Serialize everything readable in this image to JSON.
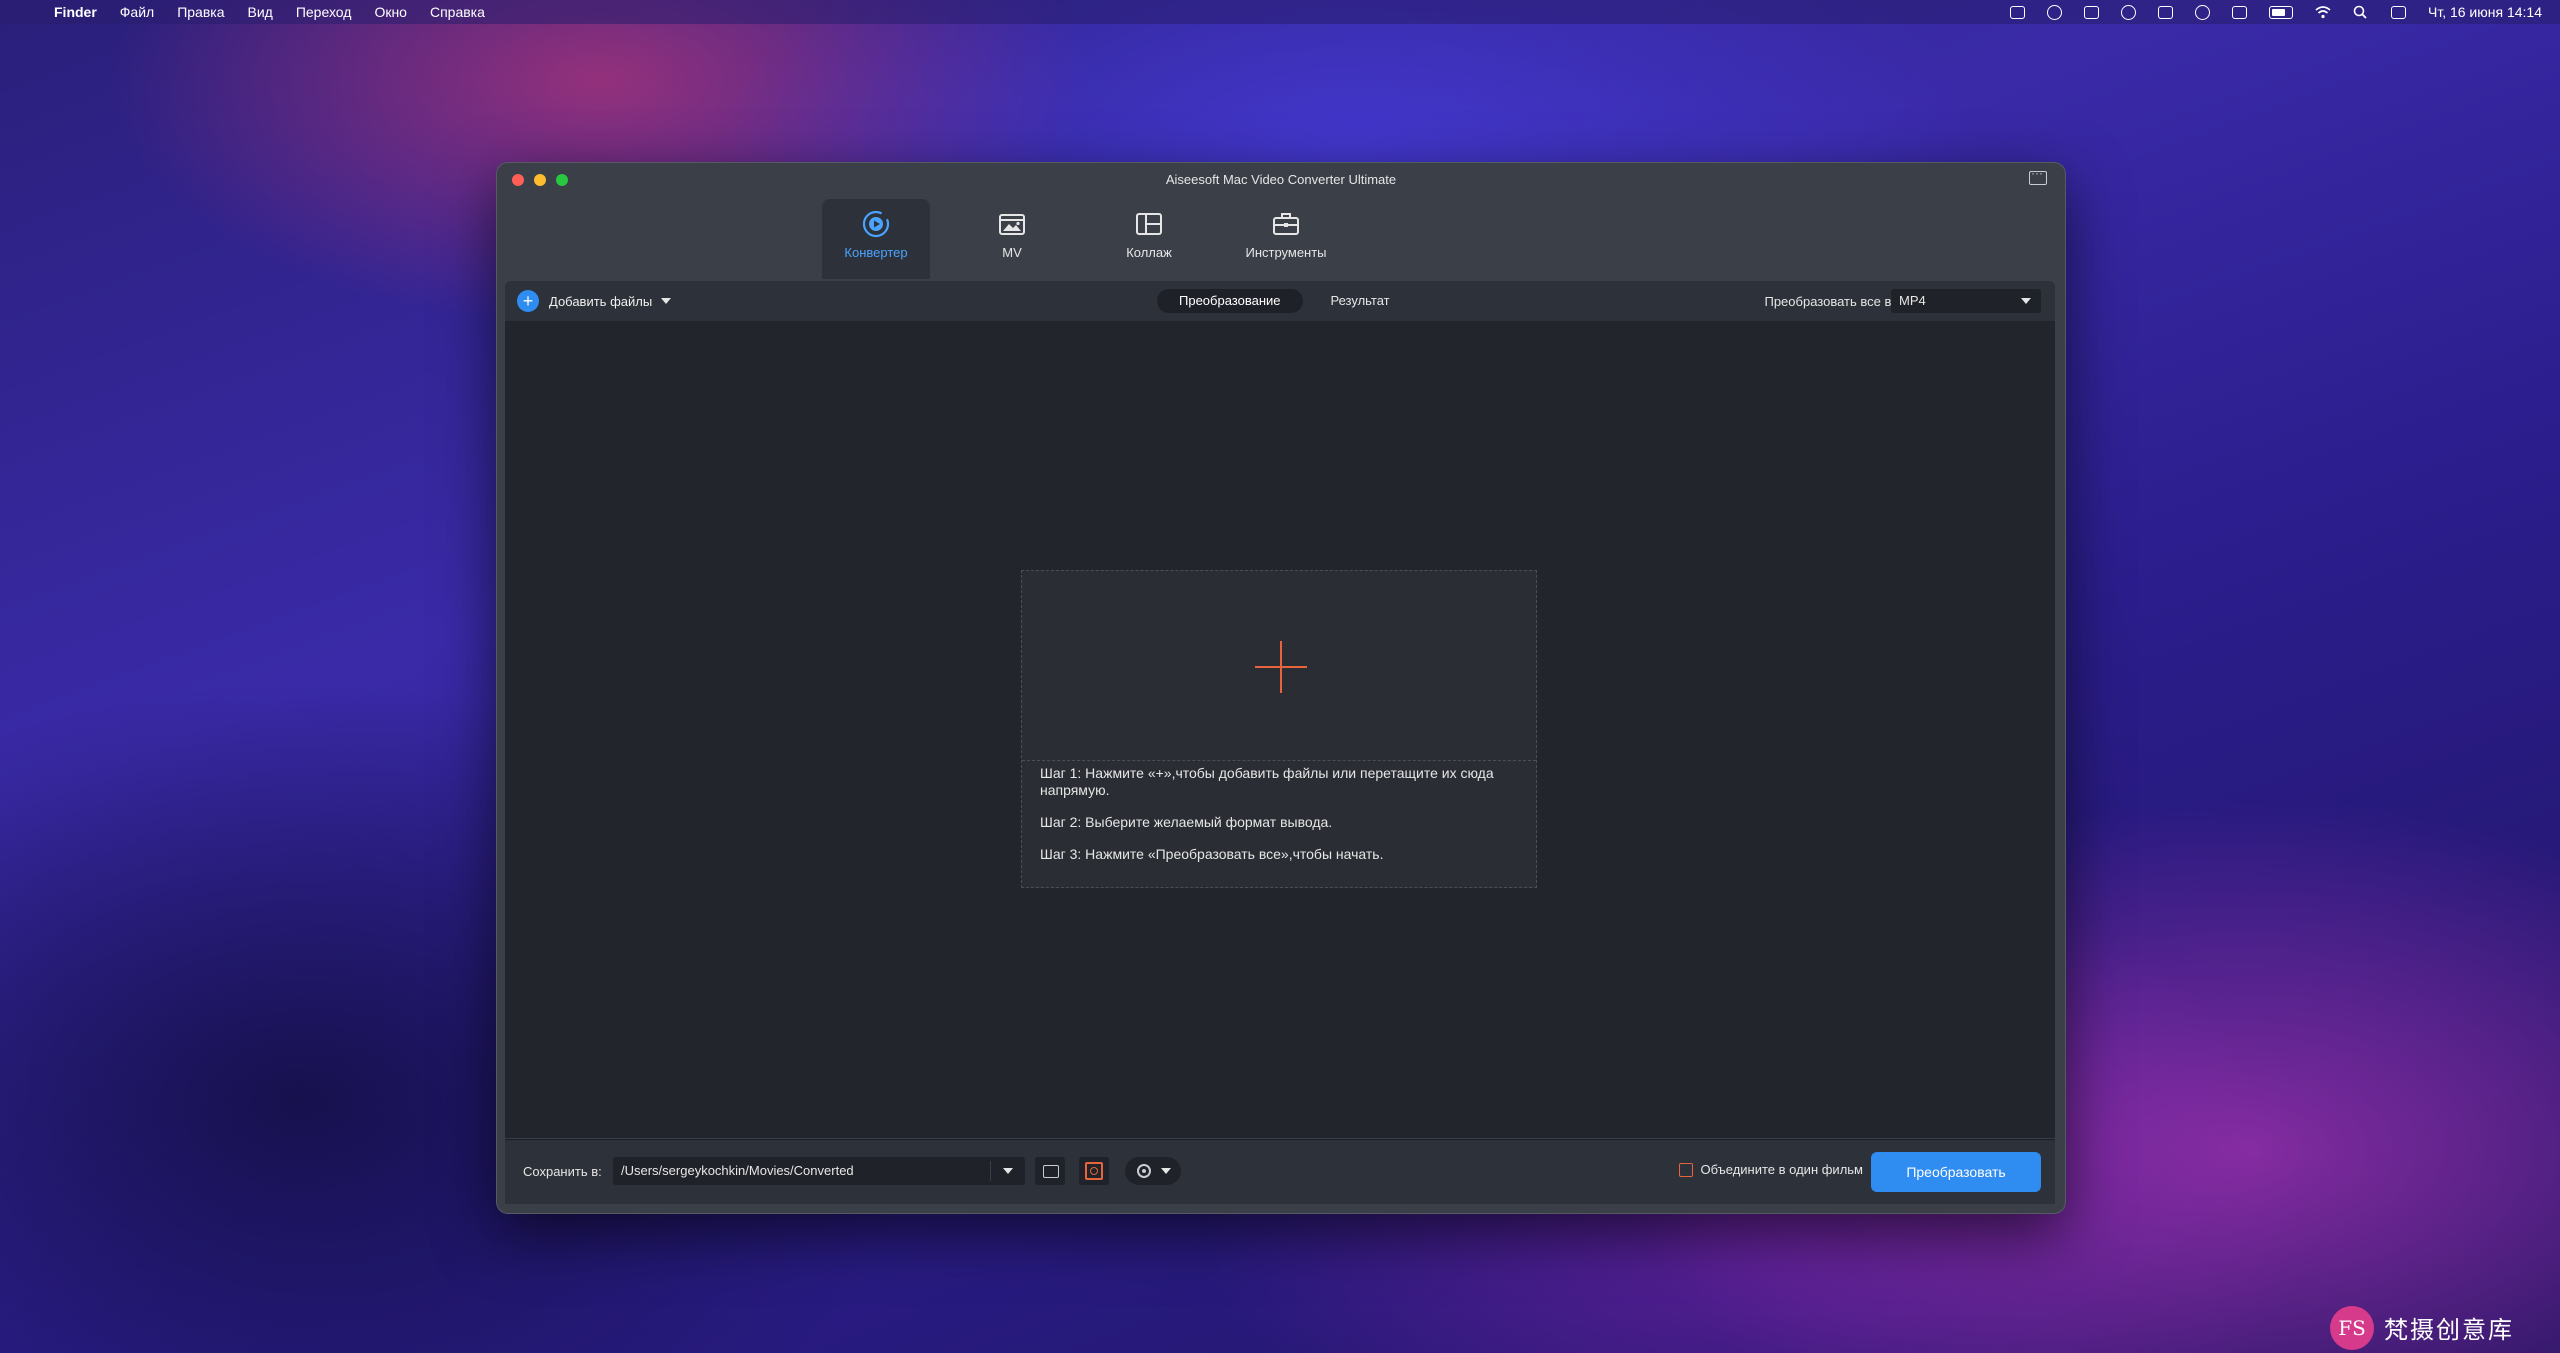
{
  "menubar": {
    "app": "Finder",
    "items": [
      "Файл",
      "Правка",
      "Вид",
      "Переход",
      "Окно",
      "Справка"
    ],
    "clock": "Чт, 16 июня  14:14"
  },
  "window": {
    "title": "Aiseesoft Mac Video Converter Ultimate"
  },
  "tabs": [
    {
      "label": "Конвертер",
      "icon": "converter-icon",
      "active": true
    },
    {
      "label": "MV",
      "icon": "mv-icon",
      "active": false
    },
    {
      "label": "Коллаж",
      "icon": "collage-icon",
      "active": false
    },
    {
      "label": "Инструменты",
      "icon": "toolbox-icon",
      "active": false
    }
  ],
  "toolbar": {
    "add_files": "Добавить файлы",
    "segments": [
      "Преобразование",
      "Результат"
    ],
    "convert_all_label": "Преобразовать все в:",
    "format": "MP4"
  },
  "dropzone": {
    "steps": [
      "Шаг 1: Нажмите «+»,чтобы добавить файлы или перетащите их сюда напрямую.",
      "Шаг 2: Выберите желаемый формат вывода.",
      "Шаг 3: Нажмите «Преобразовать все»,чтобы начать."
    ]
  },
  "bottom": {
    "save_label": "Сохранить в:",
    "path": "/Users/sergeykochkin/Movies/Converted",
    "merge_label": "Объедините в один фильм",
    "convert_button": "Преобразовать"
  },
  "watermark": {
    "text": "梵摄创意库"
  },
  "colors": {
    "accent": "#2f8cf0",
    "plus": "#e8643c",
    "window_bg": "#3a3f48",
    "content_bg": "#22252b"
  }
}
